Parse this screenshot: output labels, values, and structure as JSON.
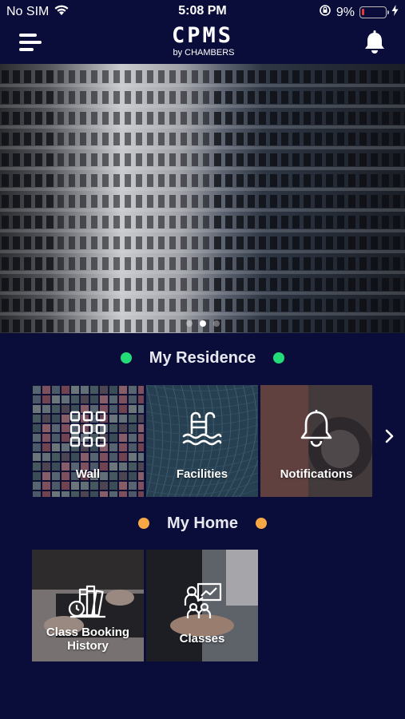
{
  "status_bar": {
    "carrier": "No SIM",
    "time": "5:08 PM",
    "battery": "9%",
    "battery_level": 0.09
  },
  "header": {
    "logo_main": "CPMS",
    "logo_by": "by",
    "logo_company": "CHAMBERS",
    "menu_icon": "hamburger-menu-icon",
    "bell_icon": "bell-icon"
  },
  "banner": {
    "slides": 3,
    "active_slide": 2
  },
  "my_residence": {
    "title": "My Residence",
    "bullet_color": "#22dd77",
    "tiles": [
      {
        "label": "Wall",
        "icon": "grid-icon"
      },
      {
        "label": "Facilities",
        "icon": "pool-ladder-icon"
      },
      {
        "label": "Notifications",
        "icon": "bell-icon"
      }
    ],
    "next_icon": "chevron-right-icon"
  },
  "my_home": {
    "title": "My Home",
    "bullet_color": "#f5a843",
    "tiles": [
      {
        "label": "Class Booking History",
        "label_line1": "Class Booking",
        "label_line2": "History",
        "icon": "books-clock-icon"
      },
      {
        "label": "Classes",
        "icon": "presentation-icon"
      }
    ]
  },
  "colors": {
    "background": "#0a0d3a",
    "text": "#ffffff"
  }
}
